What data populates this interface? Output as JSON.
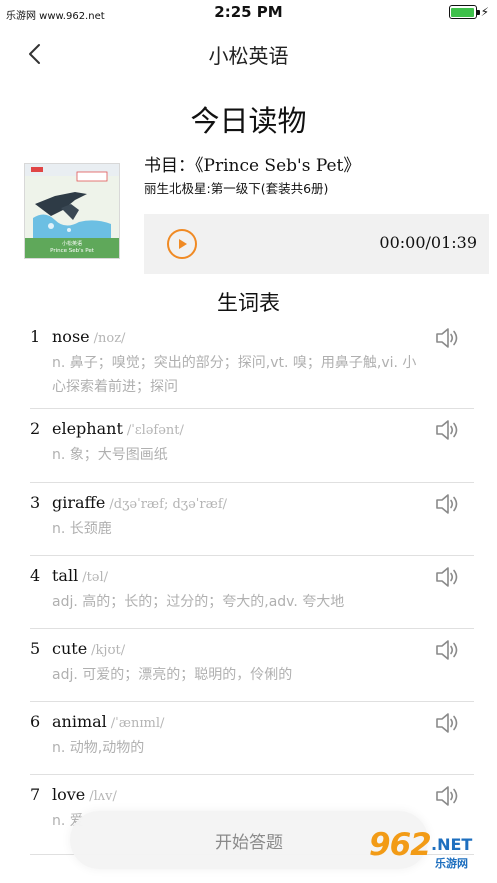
{
  "status_bar": {
    "site_label": "乐游网 www.962.net",
    "time": "2:25 PM",
    "battery_level": 1.0
  },
  "nav": {
    "back_icon": "chevron-left-icon",
    "title": "小松英语"
  },
  "reading": {
    "heading": "今日读物",
    "book_label": "书目：《Prince Seb's Pet》",
    "series": "丽生北极星:第一级下(套装共6册)",
    "cover_text": "Prince Seb's Pet"
  },
  "audio": {
    "play_icon": "play-icon",
    "time": "00:00/01:39",
    "accent_color": "#f08a24"
  },
  "vocab": {
    "title": "生词表",
    "speaker_icon": "speaker-icon",
    "items": [
      {
        "index": "1",
        "word": "nose",
        "phonetic": "/noz/",
        "definition": "n. 鼻子；嗅觉；突出的部分；探问,vt. 嗅；用鼻子触,vi. 小心探索着前进；探问"
      },
      {
        "index": "2",
        "word": "elephant",
        "phonetic": "/ˈɛləfənt/",
        "definition": "n. 象；大号图画纸"
      },
      {
        "index": "3",
        "word": "giraffe",
        "phonetic": "/dʒəˈræf; dʒəˈræf/",
        "definition": "n. 长颈鹿"
      },
      {
        "index": "4",
        "word": "tall",
        "phonetic": "/təl/",
        "definition": "adj. 高的；长的；过分的；夸大的,adv. 夸大地"
      },
      {
        "index": "5",
        "word": "cute",
        "phonetic": "/kjʊt/",
        "definition": "adj. 可爱的；漂亮的；聪明的，伶俐的"
      },
      {
        "index": "6",
        "word": "animal",
        "phonetic": "/ˈænɪml/",
        "definition": "n. 动物,动物的"
      },
      {
        "index": "7",
        "word": "love",
        "phonetic": "/lʌv/",
        "definition": "n. 爱"
      }
    ]
  },
  "actions": {
    "start_quiz": "开始答题"
  },
  "watermark": {
    "number": "962",
    "net": ".NET",
    "chinese": "乐游网"
  }
}
